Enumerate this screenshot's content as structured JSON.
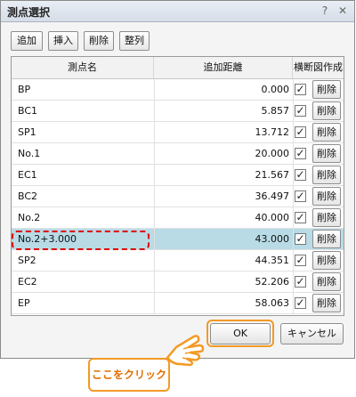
{
  "dialog": {
    "title": "測点選択"
  },
  "titlebar": {
    "help_glyph": "?",
    "close_glyph": "✕"
  },
  "toolbar": {
    "add": "追加",
    "insert": "挿入",
    "delete": "削除",
    "arrange": "整列"
  },
  "table": {
    "headers": {
      "name": "測点名",
      "distance": "追加距離",
      "section": "横断図作成"
    },
    "delete_label": "削除",
    "check_glyph": "✓",
    "rows": [
      {
        "name": "BP",
        "distance": "0.000",
        "checked": true
      },
      {
        "name": "BC1",
        "distance": "5.857",
        "checked": true
      },
      {
        "name": "SP1",
        "distance": "13.712",
        "checked": true
      },
      {
        "name": "No.1",
        "distance": "20.000",
        "checked": true
      },
      {
        "name": "EC1",
        "distance": "21.567",
        "checked": true
      },
      {
        "name": "BC2",
        "distance": "36.497",
        "checked": true
      },
      {
        "name": "No.2",
        "distance": "40.000",
        "checked": true
      },
      {
        "name": "No.2+3.000",
        "distance": "43.000",
        "checked": true,
        "selected": true
      },
      {
        "name": "SP2",
        "distance": "44.351",
        "checked": true
      },
      {
        "name": "EC2",
        "distance": "52.206",
        "checked": true
      },
      {
        "name": "EP",
        "distance": "58.063",
        "checked": true
      }
    ]
  },
  "buttons": {
    "ok": "OK",
    "cancel": "キャンセル"
  },
  "annotation": {
    "callout": "ここをクリック"
  },
  "colors": {
    "accent": "#f39a25",
    "highlight": "#e00000",
    "selected_row": "#b8dbe6"
  }
}
